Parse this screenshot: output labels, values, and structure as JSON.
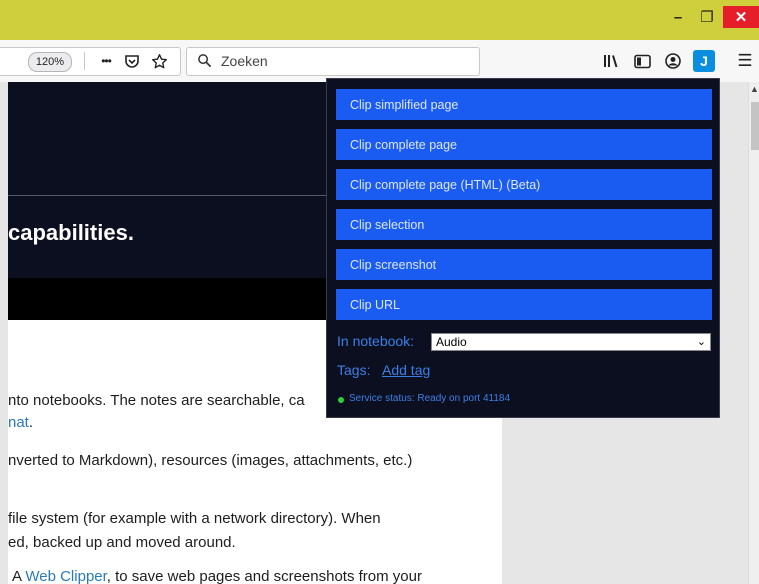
{
  "window": {
    "minimize": "–",
    "maximize": "❐",
    "close": "✕"
  },
  "toolbar": {
    "zoom": "120%",
    "more_icon": "•••",
    "search_placeholder": "Zoeken",
    "joplin_label": "J"
  },
  "page": {
    "hero_title": "capabilities.",
    "para1_line1": "nto notebooks. The notes are searchable, ca",
    "para1_link": "nat",
    "para1_end": ".",
    "para2_line1": "nverted to Markdown), resources (images, attachments, etc.)",
    "para3_line1": "file system (for example with a network directory). When",
    "para3_line2": "ed, backed up and moved around.",
    "para4_prefix": "A ",
    "para4_link": "Web Clipper",
    "para4_rest": ", to save web pages and screenshots from your"
  },
  "popup": {
    "buttons": [
      {
        "label": "Clip simplified page"
      },
      {
        "label": "Clip complete page"
      },
      {
        "label": "Clip complete page (HTML) (Beta)"
      },
      {
        "label": "Clip selection"
      },
      {
        "label": "Clip screenshot"
      },
      {
        "label": "Clip URL"
      }
    ],
    "notebook_label": "In notebook:",
    "notebook_value": "Audio",
    "tags_label": "Tags:",
    "add_tag": "Add tag",
    "status": "Service status: Ready on port 41184"
  },
  "colors": {
    "titlebar": "#cfcf3e",
    "clip_button": "#1a5cf2",
    "popup_bg": "#0b0f20",
    "link": "#3d7fe6",
    "status_ok": "#29d03a"
  }
}
